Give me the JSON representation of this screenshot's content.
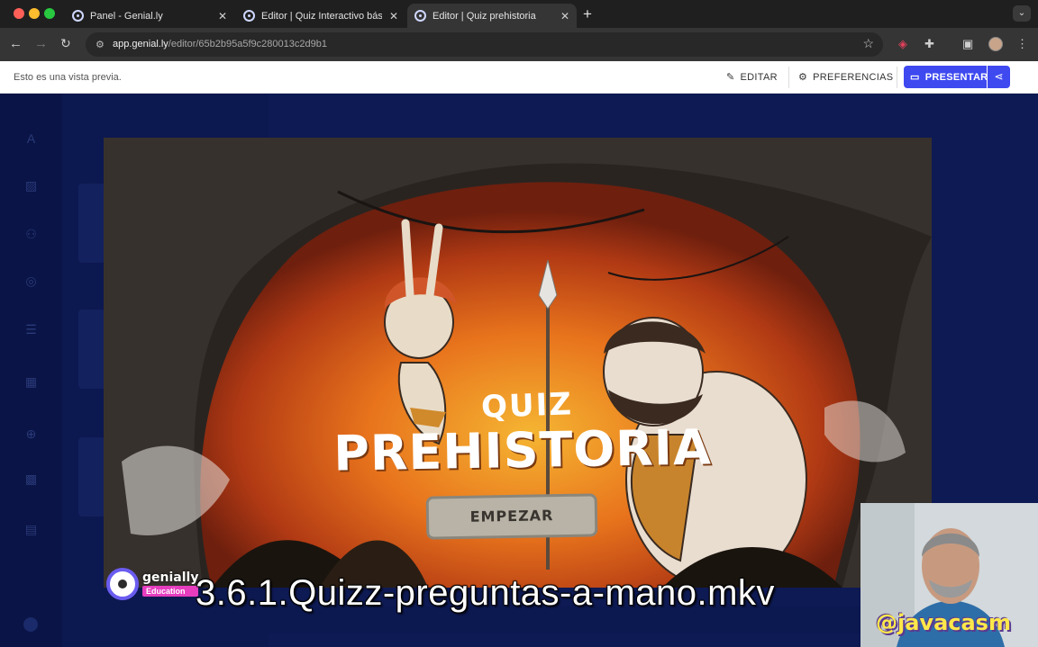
{
  "browser": {
    "tabs": [
      {
        "title": "Panel - Genial.ly",
        "active": false
      },
      {
        "title": "Editor | Quiz Interactivo básico",
        "active": false
      },
      {
        "title": "Editor | Quiz prehistoria",
        "active": true
      }
    ],
    "url_host": "app.genial.ly",
    "url_path": "/editor/65b2b95a5f9c280013c2d9b1"
  },
  "preview_bar": {
    "note": "Esto es una vista previa.",
    "edit_label": "EDITAR",
    "preferences_label": "PREFERENCIAS",
    "present_label": "PRESENTAR"
  },
  "slide": {
    "quiz_label": "QUIZ",
    "title": "PREHISTORIA",
    "start_button": "EMPEZAR"
  },
  "overlay": {
    "brand_name": "genially",
    "brand_badge": "Education",
    "caption": "3.6.1.Quizz-preguntas-a-mano.mkv",
    "handle": "@javacasm"
  },
  "colors": {
    "accent": "#3f49f0",
    "editor_bg": "#0e1a54",
    "caption_text": "#ffffff",
    "handle_text": "#ffe84a"
  }
}
